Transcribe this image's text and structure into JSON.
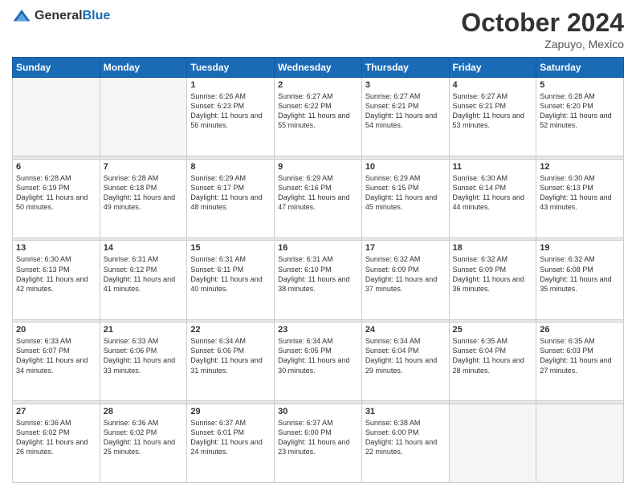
{
  "header": {
    "logo_general": "General",
    "logo_blue": "Blue",
    "month": "October 2024",
    "location": "Zapuyo, Mexico"
  },
  "weekdays": [
    "Sunday",
    "Monday",
    "Tuesday",
    "Wednesday",
    "Thursday",
    "Friday",
    "Saturday"
  ],
  "weeks": [
    [
      {
        "day": "",
        "sunrise": "",
        "sunset": "",
        "daylight": "",
        "empty": true
      },
      {
        "day": "",
        "sunrise": "",
        "sunset": "",
        "daylight": "",
        "empty": true
      },
      {
        "day": "1",
        "sunrise": "Sunrise: 6:26 AM",
        "sunset": "Sunset: 6:23 PM",
        "daylight": "Daylight: 11 hours and 56 minutes."
      },
      {
        "day": "2",
        "sunrise": "Sunrise: 6:27 AM",
        "sunset": "Sunset: 6:22 PM",
        "daylight": "Daylight: 11 hours and 55 minutes."
      },
      {
        "day": "3",
        "sunrise": "Sunrise: 6:27 AM",
        "sunset": "Sunset: 6:21 PM",
        "daylight": "Daylight: 11 hours and 54 minutes."
      },
      {
        "day": "4",
        "sunrise": "Sunrise: 6:27 AM",
        "sunset": "Sunset: 6:21 PM",
        "daylight": "Daylight: 11 hours and 53 minutes."
      },
      {
        "day": "5",
        "sunrise": "Sunrise: 6:28 AM",
        "sunset": "Sunset: 6:20 PM",
        "daylight": "Daylight: 11 hours and 52 minutes."
      }
    ],
    [
      {
        "day": "6",
        "sunrise": "Sunrise: 6:28 AM",
        "sunset": "Sunset: 6:19 PM",
        "daylight": "Daylight: 11 hours and 50 minutes."
      },
      {
        "day": "7",
        "sunrise": "Sunrise: 6:28 AM",
        "sunset": "Sunset: 6:18 PM",
        "daylight": "Daylight: 11 hours and 49 minutes."
      },
      {
        "day": "8",
        "sunrise": "Sunrise: 6:29 AM",
        "sunset": "Sunset: 6:17 PM",
        "daylight": "Daylight: 11 hours and 48 minutes."
      },
      {
        "day": "9",
        "sunrise": "Sunrise: 6:29 AM",
        "sunset": "Sunset: 6:16 PM",
        "daylight": "Daylight: 11 hours and 47 minutes."
      },
      {
        "day": "10",
        "sunrise": "Sunrise: 6:29 AM",
        "sunset": "Sunset: 6:15 PM",
        "daylight": "Daylight: 11 hours and 45 minutes."
      },
      {
        "day": "11",
        "sunrise": "Sunrise: 6:30 AM",
        "sunset": "Sunset: 6:14 PM",
        "daylight": "Daylight: 11 hours and 44 minutes."
      },
      {
        "day": "12",
        "sunrise": "Sunrise: 6:30 AM",
        "sunset": "Sunset: 6:13 PM",
        "daylight": "Daylight: 11 hours and 43 minutes."
      }
    ],
    [
      {
        "day": "13",
        "sunrise": "Sunrise: 6:30 AM",
        "sunset": "Sunset: 6:13 PM",
        "daylight": "Daylight: 11 hours and 42 minutes."
      },
      {
        "day": "14",
        "sunrise": "Sunrise: 6:31 AM",
        "sunset": "Sunset: 6:12 PM",
        "daylight": "Daylight: 11 hours and 41 minutes."
      },
      {
        "day": "15",
        "sunrise": "Sunrise: 6:31 AM",
        "sunset": "Sunset: 6:11 PM",
        "daylight": "Daylight: 11 hours and 40 minutes."
      },
      {
        "day": "16",
        "sunrise": "Sunrise: 6:31 AM",
        "sunset": "Sunset: 6:10 PM",
        "daylight": "Daylight: 11 hours and 38 minutes."
      },
      {
        "day": "17",
        "sunrise": "Sunrise: 6:32 AM",
        "sunset": "Sunset: 6:09 PM",
        "daylight": "Daylight: 11 hours and 37 minutes."
      },
      {
        "day": "18",
        "sunrise": "Sunrise: 6:32 AM",
        "sunset": "Sunset: 6:09 PM",
        "daylight": "Daylight: 11 hours and 36 minutes."
      },
      {
        "day": "19",
        "sunrise": "Sunrise: 6:32 AM",
        "sunset": "Sunset: 6:08 PM",
        "daylight": "Daylight: 11 hours and 35 minutes."
      }
    ],
    [
      {
        "day": "20",
        "sunrise": "Sunrise: 6:33 AM",
        "sunset": "Sunset: 6:07 PM",
        "daylight": "Daylight: 11 hours and 34 minutes."
      },
      {
        "day": "21",
        "sunrise": "Sunrise: 6:33 AM",
        "sunset": "Sunset: 6:06 PM",
        "daylight": "Daylight: 11 hours and 33 minutes."
      },
      {
        "day": "22",
        "sunrise": "Sunrise: 6:34 AM",
        "sunset": "Sunset: 6:06 PM",
        "daylight": "Daylight: 11 hours and 31 minutes."
      },
      {
        "day": "23",
        "sunrise": "Sunrise: 6:34 AM",
        "sunset": "Sunset: 6:05 PM",
        "daylight": "Daylight: 11 hours and 30 minutes."
      },
      {
        "day": "24",
        "sunrise": "Sunrise: 6:34 AM",
        "sunset": "Sunset: 6:04 PM",
        "daylight": "Daylight: 11 hours and 29 minutes."
      },
      {
        "day": "25",
        "sunrise": "Sunrise: 6:35 AM",
        "sunset": "Sunset: 6:04 PM",
        "daylight": "Daylight: 11 hours and 28 minutes."
      },
      {
        "day": "26",
        "sunrise": "Sunrise: 6:35 AM",
        "sunset": "Sunset: 6:03 PM",
        "daylight": "Daylight: 11 hours and 27 minutes."
      }
    ],
    [
      {
        "day": "27",
        "sunrise": "Sunrise: 6:36 AM",
        "sunset": "Sunset: 6:02 PM",
        "daylight": "Daylight: 11 hours and 26 minutes."
      },
      {
        "day": "28",
        "sunrise": "Sunrise: 6:36 AM",
        "sunset": "Sunset: 6:02 PM",
        "daylight": "Daylight: 11 hours and 25 minutes."
      },
      {
        "day": "29",
        "sunrise": "Sunrise: 6:37 AM",
        "sunset": "Sunset: 6:01 PM",
        "daylight": "Daylight: 11 hours and 24 minutes."
      },
      {
        "day": "30",
        "sunrise": "Sunrise: 6:37 AM",
        "sunset": "Sunset: 6:00 PM",
        "daylight": "Daylight: 11 hours and 23 minutes."
      },
      {
        "day": "31",
        "sunrise": "Sunrise: 6:38 AM",
        "sunset": "Sunset: 6:00 PM",
        "daylight": "Daylight: 11 hours and 22 minutes."
      },
      {
        "day": "",
        "sunrise": "",
        "sunset": "",
        "daylight": "",
        "empty": true
      },
      {
        "day": "",
        "sunrise": "",
        "sunset": "",
        "daylight": "",
        "empty": true
      }
    ]
  ]
}
